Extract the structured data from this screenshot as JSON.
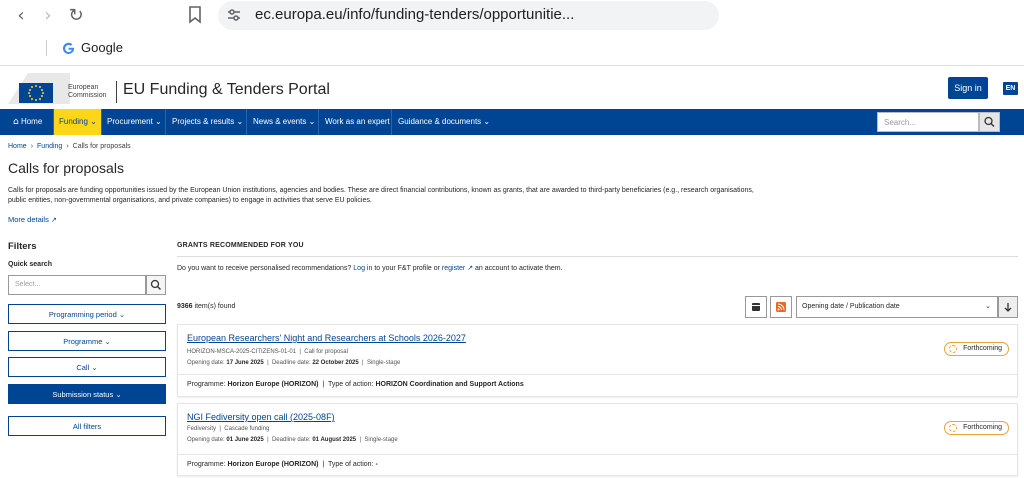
{
  "browser": {
    "url": "ec.europa.eu/info/funding-tenders/opportunitie...",
    "bookmark_label": "Google"
  },
  "header": {
    "logo_line1": "European",
    "logo_line2": "Commission",
    "portal_title": "EU Funding & Tenders Portal",
    "sign_in": "Sign in",
    "lang": "EN"
  },
  "nav": {
    "items": [
      "Home",
      "Funding",
      "Procurement",
      "Projects & results",
      "News & events",
      "Work as an expert",
      "Guidance & documents"
    ],
    "search_placeholder": "Search..."
  },
  "breadcrumb": [
    "Home",
    "Funding",
    "Calls for proposals"
  ],
  "page": {
    "title": "Calls for proposals",
    "intro": "Calls for proposals are funding opportunities issued by the European Union institutions, agencies and bodies. These are direct financial contributions, known as grants, that are awarded to third-party beneficiaries (e.g., research organisations, public entities, non-governmental organisations, and private companies) to engage in activities that serve EU policies.",
    "more_details": "More details"
  },
  "filters": {
    "title": "Filters",
    "quick_search_label": "Quick search",
    "quick_search_placeholder": "Select...",
    "buttons": [
      "Programming period",
      "Programme",
      "Call",
      "Submission status"
    ],
    "all_filters": "All filters"
  },
  "main": {
    "grants_title": "GRANTS RECOMMENDED FOR YOU",
    "reco_text_1": "Do you want to receive personalised recommendations?",
    "login": "Log in",
    "reco_text_2": "to your F&T profile or",
    "register": "register",
    "reco_text_3": "an account to activate them.",
    "count": "9366",
    "count_suffix": "item(s) found",
    "sort": "Opening date / Publication date"
  },
  "cards": [
    {
      "title": "European Researchers' Night and Researchers at Schools 2026-2027",
      "id": "HORIZON-MSCA-2025-CITIZENS-01-01",
      "type": "Call for proposal",
      "opening_label": "Opening date:",
      "opening": "17 June 2025",
      "deadline_label": "Deadline date:",
      "deadline": "22 October 2025",
      "stage": "Single-stage",
      "status": "Forthcoming",
      "programme_label": "Programme:",
      "programme": "Horizon Europe (HORIZON)",
      "action_label": "Type of action:",
      "action": "HORIZON Coordination and Support Actions"
    },
    {
      "title": "NGI Fediversity open call (2025-08F)",
      "id": "Fediversity",
      "type": "Cascade funding",
      "opening_label": "Opening date:",
      "opening": "01 June 2025",
      "deadline_label": "Deadline date:",
      "deadline": "01 August 2025",
      "stage": "Single-stage",
      "status": "Forthcoming",
      "programme_label": "Programme:",
      "programme": "Horizon Europe (HORIZON)",
      "action_label": "Type of action:",
      "action": "-"
    }
  ],
  "colors": {
    "primary": "#004494",
    "accent": "#ffd617",
    "forthcoming": "#e8a33d"
  }
}
